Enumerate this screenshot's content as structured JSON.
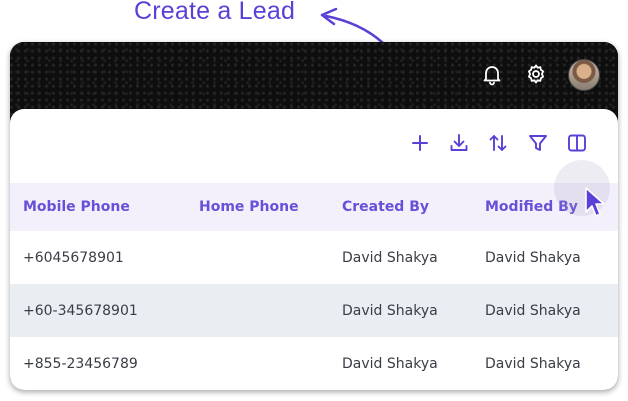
{
  "annotation": {
    "text": "Create a Lead"
  },
  "header": {
    "icons": [
      "bell-icon",
      "gear-icon",
      "avatar"
    ]
  },
  "toolbar": {
    "icons": [
      "plus-icon",
      "download-icon",
      "sort-icon",
      "filter-icon",
      "columns-icon"
    ]
  },
  "table": {
    "columns": [
      "Mobile Phone",
      "Home Phone",
      "Created By",
      "Modified By"
    ],
    "rows": [
      {
        "mobile": "+6045678901",
        "home": "",
        "created": "David Shakya",
        "modified": "David Shakya"
      },
      {
        "mobile": "+60-345678901",
        "home": "",
        "created": "David Shakya",
        "modified": "David Shakya"
      },
      {
        "mobile": "+855-23456789",
        "home": "",
        "created": "David Shakya",
        "modified": "David Shakya"
      }
    ]
  },
  "colors": {
    "accent": "#5b3fd6",
    "header_bg": "#f3f0fb",
    "alt_row": "#eaedf1"
  }
}
